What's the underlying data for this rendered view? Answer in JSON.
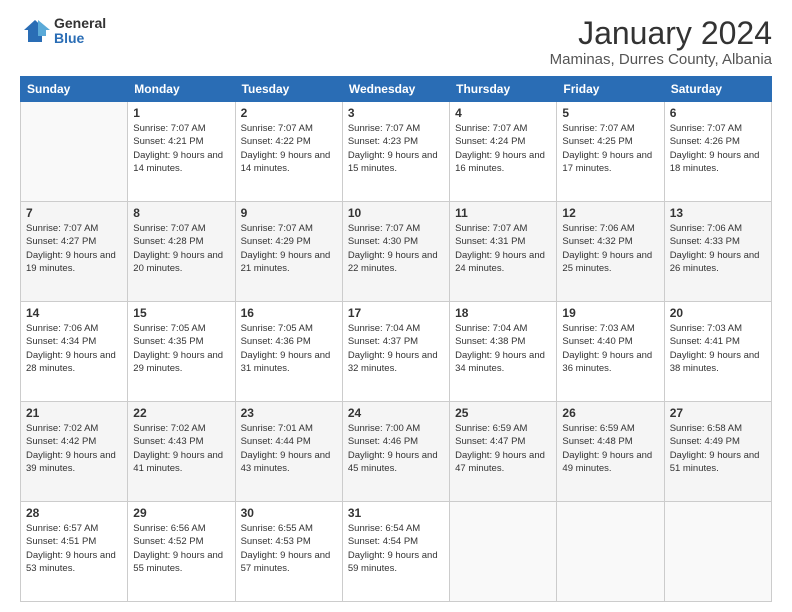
{
  "logo": {
    "general": "General",
    "blue": "Blue"
  },
  "title": "January 2024",
  "subtitle": "Maminas, Durres County, Albania",
  "days_of_week": [
    "Sunday",
    "Monday",
    "Tuesday",
    "Wednesday",
    "Thursday",
    "Friday",
    "Saturday"
  ],
  "weeks": [
    [
      {
        "day": "",
        "sunrise": "",
        "sunset": "",
        "daylight": ""
      },
      {
        "day": "1",
        "sunrise": "Sunrise: 7:07 AM",
        "sunset": "Sunset: 4:21 PM",
        "daylight": "Daylight: 9 hours and 14 minutes."
      },
      {
        "day": "2",
        "sunrise": "Sunrise: 7:07 AM",
        "sunset": "Sunset: 4:22 PM",
        "daylight": "Daylight: 9 hours and 14 minutes."
      },
      {
        "day": "3",
        "sunrise": "Sunrise: 7:07 AM",
        "sunset": "Sunset: 4:23 PM",
        "daylight": "Daylight: 9 hours and 15 minutes."
      },
      {
        "day": "4",
        "sunrise": "Sunrise: 7:07 AM",
        "sunset": "Sunset: 4:24 PM",
        "daylight": "Daylight: 9 hours and 16 minutes."
      },
      {
        "day": "5",
        "sunrise": "Sunrise: 7:07 AM",
        "sunset": "Sunset: 4:25 PM",
        "daylight": "Daylight: 9 hours and 17 minutes."
      },
      {
        "day": "6",
        "sunrise": "Sunrise: 7:07 AM",
        "sunset": "Sunset: 4:26 PM",
        "daylight": "Daylight: 9 hours and 18 minutes."
      }
    ],
    [
      {
        "day": "7",
        "sunrise": "Sunrise: 7:07 AM",
        "sunset": "Sunset: 4:27 PM",
        "daylight": "Daylight: 9 hours and 19 minutes."
      },
      {
        "day": "8",
        "sunrise": "Sunrise: 7:07 AM",
        "sunset": "Sunset: 4:28 PM",
        "daylight": "Daylight: 9 hours and 20 minutes."
      },
      {
        "day": "9",
        "sunrise": "Sunrise: 7:07 AM",
        "sunset": "Sunset: 4:29 PM",
        "daylight": "Daylight: 9 hours and 21 minutes."
      },
      {
        "day": "10",
        "sunrise": "Sunrise: 7:07 AM",
        "sunset": "Sunset: 4:30 PM",
        "daylight": "Daylight: 9 hours and 22 minutes."
      },
      {
        "day": "11",
        "sunrise": "Sunrise: 7:07 AM",
        "sunset": "Sunset: 4:31 PM",
        "daylight": "Daylight: 9 hours and 24 minutes."
      },
      {
        "day": "12",
        "sunrise": "Sunrise: 7:06 AM",
        "sunset": "Sunset: 4:32 PM",
        "daylight": "Daylight: 9 hours and 25 minutes."
      },
      {
        "day": "13",
        "sunrise": "Sunrise: 7:06 AM",
        "sunset": "Sunset: 4:33 PM",
        "daylight": "Daylight: 9 hours and 26 minutes."
      }
    ],
    [
      {
        "day": "14",
        "sunrise": "Sunrise: 7:06 AM",
        "sunset": "Sunset: 4:34 PM",
        "daylight": "Daylight: 9 hours and 28 minutes."
      },
      {
        "day": "15",
        "sunrise": "Sunrise: 7:05 AM",
        "sunset": "Sunset: 4:35 PM",
        "daylight": "Daylight: 9 hours and 29 minutes."
      },
      {
        "day": "16",
        "sunrise": "Sunrise: 7:05 AM",
        "sunset": "Sunset: 4:36 PM",
        "daylight": "Daylight: 9 hours and 31 minutes."
      },
      {
        "day": "17",
        "sunrise": "Sunrise: 7:04 AM",
        "sunset": "Sunset: 4:37 PM",
        "daylight": "Daylight: 9 hours and 32 minutes."
      },
      {
        "day": "18",
        "sunrise": "Sunrise: 7:04 AM",
        "sunset": "Sunset: 4:38 PM",
        "daylight": "Daylight: 9 hours and 34 minutes."
      },
      {
        "day": "19",
        "sunrise": "Sunrise: 7:03 AM",
        "sunset": "Sunset: 4:40 PM",
        "daylight": "Daylight: 9 hours and 36 minutes."
      },
      {
        "day": "20",
        "sunrise": "Sunrise: 7:03 AM",
        "sunset": "Sunset: 4:41 PM",
        "daylight": "Daylight: 9 hours and 38 minutes."
      }
    ],
    [
      {
        "day": "21",
        "sunrise": "Sunrise: 7:02 AM",
        "sunset": "Sunset: 4:42 PM",
        "daylight": "Daylight: 9 hours and 39 minutes."
      },
      {
        "day": "22",
        "sunrise": "Sunrise: 7:02 AM",
        "sunset": "Sunset: 4:43 PM",
        "daylight": "Daylight: 9 hours and 41 minutes."
      },
      {
        "day": "23",
        "sunrise": "Sunrise: 7:01 AM",
        "sunset": "Sunset: 4:44 PM",
        "daylight": "Daylight: 9 hours and 43 minutes."
      },
      {
        "day": "24",
        "sunrise": "Sunrise: 7:00 AM",
        "sunset": "Sunset: 4:46 PM",
        "daylight": "Daylight: 9 hours and 45 minutes."
      },
      {
        "day": "25",
        "sunrise": "Sunrise: 6:59 AM",
        "sunset": "Sunset: 4:47 PM",
        "daylight": "Daylight: 9 hours and 47 minutes."
      },
      {
        "day": "26",
        "sunrise": "Sunrise: 6:59 AM",
        "sunset": "Sunset: 4:48 PM",
        "daylight": "Daylight: 9 hours and 49 minutes."
      },
      {
        "day": "27",
        "sunrise": "Sunrise: 6:58 AM",
        "sunset": "Sunset: 4:49 PM",
        "daylight": "Daylight: 9 hours and 51 minutes."
      }
    ],
    [
      {
        "day": "28",
        "sunrise": "Sunrise: 6:57 AM",
        "sunset": "Sunset: 4:51 PM",
        "daylight": "Daylight: 9 hours and 53 minutes."
      },
      {
        "day": "29",
        "sunrise": "Sunrise: 6:56 AM",
        "sunset": "Sunset: 4:52 PM",
        "daylight": "Daylight: 9 hours and 55 minutes."
      },
      {
        "day": "30",
        "sunrise": "Sunrise: 6:55 AM",
        "sunset": "Sunset: 4:53 PM",
        "daylight": "Daylight: 9 hours and 57 minutes."
      },
      {
        "day": "31",
        "sunrise": "Sunrise: 6:54 AM",
        "sunset": "Sunset: 4:54 PM",
        "daylight": "Daylight: 9 hours and 59 minutes."
      },
      {
        "day": "",
        "sunrise": "",
        "sunset": "",
        "daylight": ""
      },
      {
        "day": "",
        "sunrise": "",
        "sunset": "",
        "daylight": ""
      },
      {
        "day": "",
        "sunrise": "",
        "sunset": "",
        "daylight": ""
      }
    ]
  ]
}
